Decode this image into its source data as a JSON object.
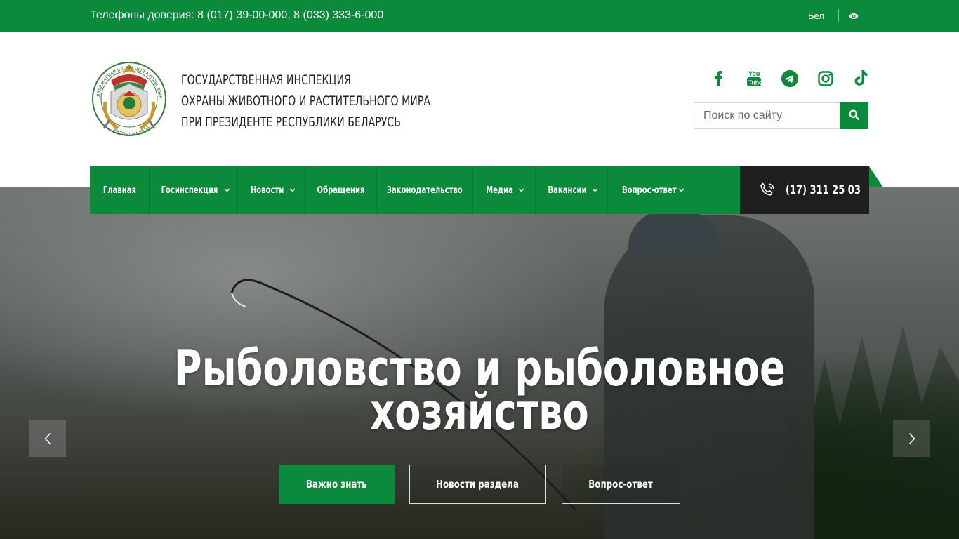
{
  "topbar": {
    "phones": "Телефоны доверия: 8 (017) 39-00-000, 8 (033) 333-6-000",
    "language": "Бел",
    "accessibility_icon": "eye-icon"
  },
  "header": {
    "org_title": [
      "ГОСУДАРСТВЕННАЯ ИНСПЕКЦИЯ",
      "ОХРАНЫ ЖИВОТНОГО И РАСТИТЕЛЬНОГО МИРА",
      "ПРИ ПРЕЗИДЕНТЕ РЕСПУБЛИКИ БЕЛАРУСЬ"
    ],
    "emblem_text": "Дзяржаўная інспекцыя аховы жывёльнага і расліннага свету — Рэспубліка Беларусь",
    "socials": [
      {
        "name": "facebook",
        "icon": "facebook-icon"
      },
      {
        "name": "youtube",
        "icon": "youtube-icon"
      },
      {
        "name": "telegram",
        "icon": "telegram-icon"
      },
      {
        "name": "instagram",
        "icon": "instagram-icon"
      },
      {
        "name": "tiktok",
        "icon": "tiktok-icon"
      }
    ],
    "search": {
      "placeholder": "Поиск по сайту",
      "value": "",
      "button_icon": "search-icon"
    }
  },
  "nav": {
    "items": [
      {
        "label": "Главная",
        "dropdown": false
      },
      {
        "label": "Госинспекция",
        "dropdown": true
      },
      {
        "label": "Новости",
        "dropdown": true
      },
      {
        "label": "Обращения",
        "dropdown": false
      },
      {
        "label": "Законодательство",
        "dropdown": false
      },
      {
        "label": "Медиа",
        "dropdown": true
      },
      {
        "label": "Вакансии",
        "dropdown": true
      },
      {
        "label": "Вопрос-ответ",
        "dropdown": true
      }
    ],
    "phone": "(17) 311 25 03"
  },
  "hero": {
    "title_line1": "Рыболовство и рыболовное",
    "title_line2": "хозяйство",
    "buttons": [
      {
        "label": "Важно знать",
        "style": "primary"
      },
      {
        "label": "Новости раздела",
        "style": "outline"
      },
      {
        "label": "Вопрос-ответ",
        "style": "outline"
      }
    ],
    "prev_icon": "chevron-left-icon",
    "next_icon": "chevron-right-icon"
  },
  "colors": {
    "brand_green": "#0a8a3a",
    "dark": "#1f1f1f",
    "white": "#ffffff"
  }
}
